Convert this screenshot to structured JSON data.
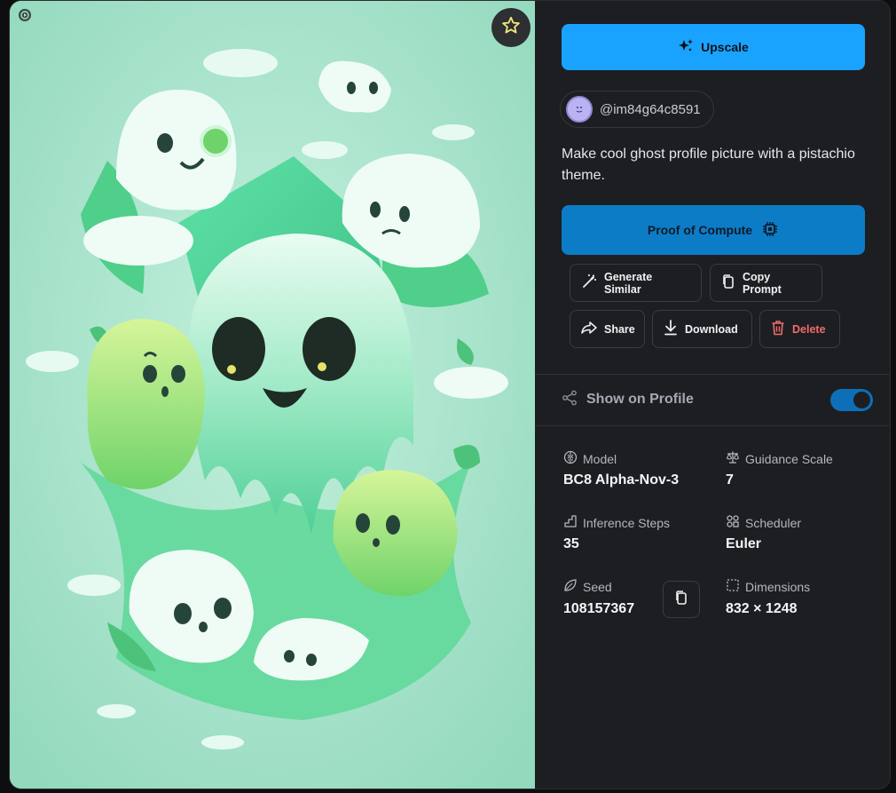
{
  "actions": {
    "upscale_label": "Upscale",
    "proof_label": "Proof of Compute",
    "generate_similar_label": "Generate Similar",
    "copy_prompt_label": "Copy Prompt",
    "share_label": "Share",
    "download_label": "Download",
    "delete_label": "Delete"
  },
  "user": {
    "handle": "@im84g64c8591"
  },
  "prompt": "Make cool ghost profile picture with a pistachio theme.",
  "profile": {
    "show_on_profile_label": "Show on Profile",
    "show_on_profile_enabled": true
  },
  "meta": {
    "model_label": "Model",
    "model_value": "BC8 Alpha-Nov-3",
    "guidance_label": "Guidance Scale",
    "guidance_value": "7",
    "steps_label": "Inference Steps",
    "steps_value": "35",
    "scheduler_label": "Scheduler",
    "scheduler_value": "Euler",
    "seed_label": "Seed",
    "seed_value": "108157367",
    "dimensions_label": "Dimensions",
    "dimensions_value": "832 × 1248"
  },
  "colors": {
    "accent": "#19a3ff",
    "proof": "#0d7cc7",
    "danger": "#f26b6b",
    "panel": "#1d1e22",
    "image_bg": "#a8e3cc"
  },
  "icons": [
    "play-icon",
    "star-icon",
    "sparkles-icon",
    "chip-icon",
    "magic-wand-icon",
    "copy-icon",
    "share-icon",
    "download-icon",
    "trash-icon",
    "share-nodes-icon",
    "brain-icon",
    "scale-icon",
    "steps-icon",
    "scheduler-icon",
    "leaf-icon",
    "dimensions-icon"
  ]
}
